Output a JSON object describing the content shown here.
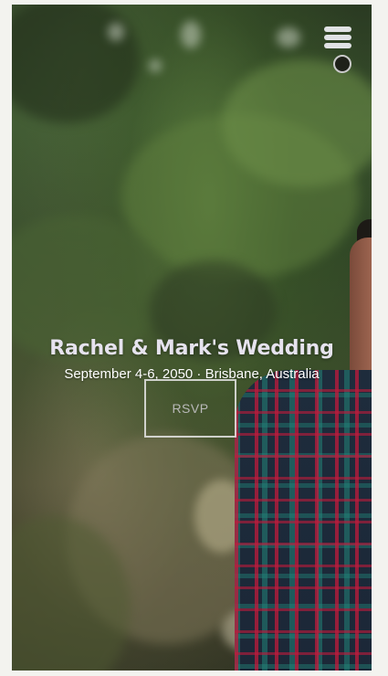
{
  "hero": {
    "title": "Rachel & Mark's Wedding",
    "subtitle": "September 4-6, 2050 · Brisbane, Australia",
    "rsvp_label": "RSVP"
  },
  "nav": {
    "menu_icon": "hamburger-icon",
    "indicator_icon": "circle-indicator-icon"
  },
  "colors": {
    "page_background": "#f3f3ef",
    "title_text": "#e6e3ee",
    "subtitle_text": "#ffffff",
    "button_border": "#e6e6e6",
    "button_text": "#b9b9b9"
  }
}
